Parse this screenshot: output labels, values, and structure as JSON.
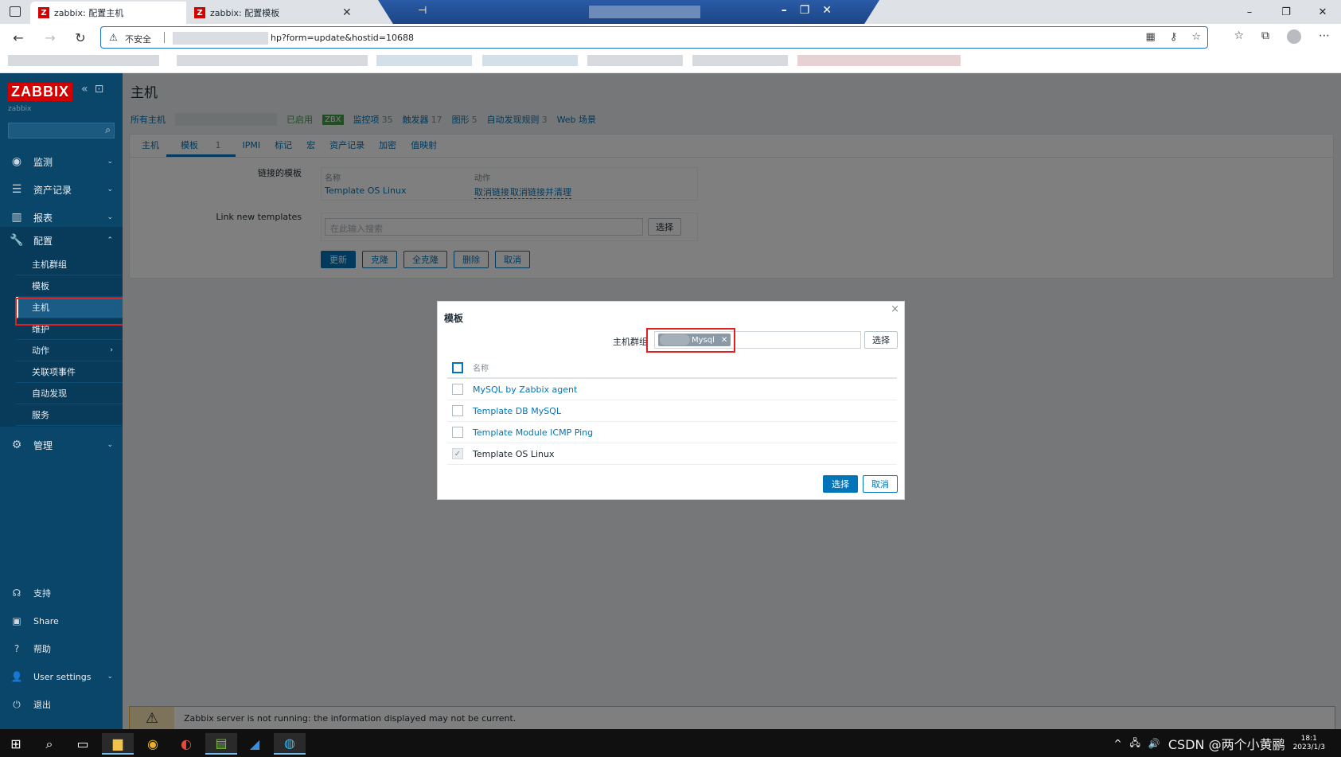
{
  "browser": {
    "tabs": [
      {
        "title": "zabbix: 配置主机",
        "active": true
      },
      {
        "title": "zabbix: 配置模板",
        "active": false
      }
    ],
    "remote_pin": "⊣",
    "insecure_label": "不安全",
    "url_visible": "hp?form=update&hostid=10688"
  },
  "sidebar": {
    "brand": "ZABBIX",
    "server_name": "zabbix",
    "menu": [
      {
        "label": "监测",
        "icon": "eye-icon"
      },
      {
        "label": "资产记录",
        "icon": "list-icon"
      },
      {
        "label": "报表",
        "icon": "chart-icon"
      },
      {
        "label": "配置",
        "icon": "wrench-icon"
      }
    ],
    "config_sub": [
      {
        "label": "主机群组"
      },
      {
        "label": "模板"
      },
      {
        "label": "主机",
        "selected": true
      },
      {
        "label": "维护"
      },
      {
        "label": "动作",
        "has_children": true
      },
      {
        "label": "关联项事件"
      },
      {
        "label": "自动发现"
      },
      {
        "label": "服务"
      }
    ],
    "admin": "管理",
    "footer": [
      {
        "label": "支持",
        "icon": "headset-icon"
      },
      {
        "label": "Share",
        "icon": "zabbix-share-icon"
      },
      {
        "label": "帮助",
        "icon": "help-icon"
      },
      {
        "label": "User settings",
        "icon": "user-icon"
      },
      {
        "label": "退出",
        "icon": "power-icon"
      }
    ]
  },
  "main": {
    "title": "主机",
    "breadcrumbs": {
      "all_hosts": "所有主机",
      "enabled": "已启用",
      "zbx": "ZBX",
      "items": "监控项",
      "items_count": "35",
      "triggers": "触发器",
      "triggers_count": "17",
      "graphs": "图形",
      "graphs_count": "5",
      "discovery": "自动发现规则",
      "discovery_count": "3",
      "web": "Web 场景"
    },
    "tabs": [
      {
        "label": "主机"
      },
      {
        "label": "模板",
        "count": "1",
        "active": true
      },
      {
        "label": "IPMI"
      },
      {
        "label": "标记"
      },
      {
        "label": "宏"
      },
      {
        "label": "资产记录"
      },
      {
        "label": "加密"
      },
      {
        "label": "值映射"
      }
    ],
    "linked_templates_label": "链接的模板",
    "col_name": "名称",
    "col_action": "动作",
    "linked_template": "Template OS Linux",
    "unlink": "取消链接",
    "unlink_clear": "取消链接并清理",
    "link_new_label": "Link new templates",
    "search_placeholder": "在此输入搜索",
    "select_btn": "选择",
    "buttons": {
      "update": "更新",
      "clone": "克隆",
      "full_clone": "全克隆",
      "delete": "删除",
      "cancel": "取消"
    },
    "warning": "Zabbix server is not running: the information displayed may not be current."
  },
  "dialog": {
    "title": "模板",
    "close": "×",
    "hostgroup_label": "主机群组",
    "chip_text": "Mysql",
    "select_btn": "选择",
    "col_name": "名称",
    "rows": [
      {
        "name": "MySQL by Zabbix agent",
        "checked": false,
        "disabled": false
      },
      {
        "name": "Template DB MySQL",
        "checked": false,
        "disabled": false
      },
      {
        "name": "Template Module ICMP Ping",
        "checked": false,
        "disabled": false
      },
      {
        "name": "Template OS Linux",
        "checked": true,
        "disabled": true
      }
    ],
    "ok_btn": "选择",
    "cancel_btn": "取消"
  },
  "taskbar": {
    "watermark": "CSDN @两个小黄鹂",
    "time": "18:1",
    "date": "2023/1/3"
  }
}
